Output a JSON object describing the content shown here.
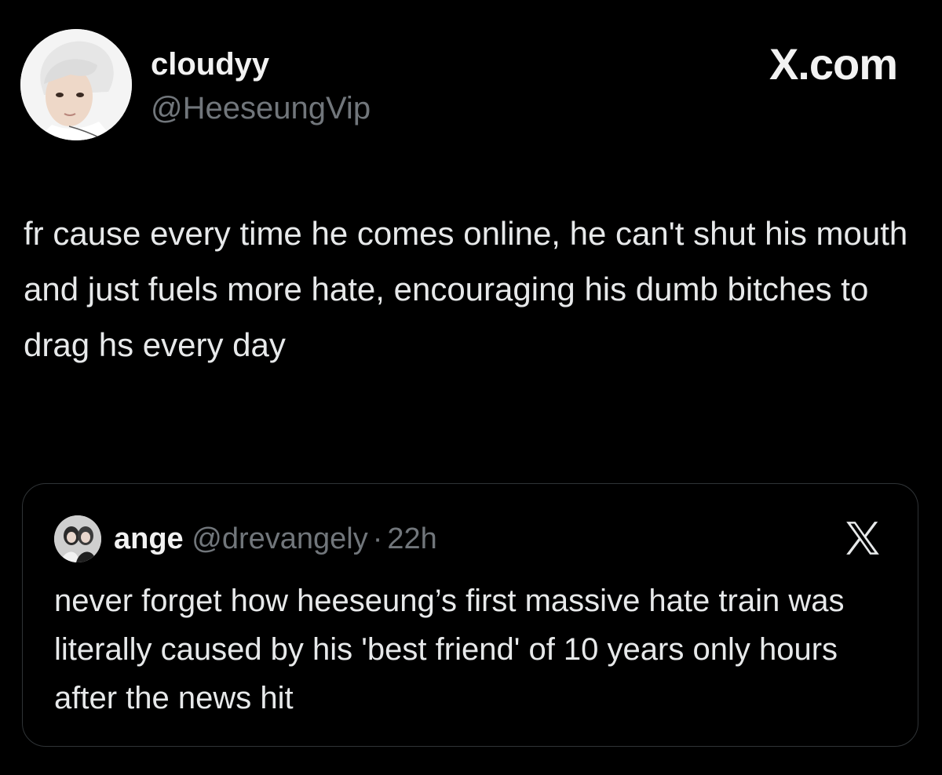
{
  "author": {
    "name": "cloudyy",
    "handle": "@HeeseungVip"
  },
  "brand": {
    "label": "X.com"
  },
  "post": {
    "text": "fr cause every time he comes online, he can't shut his mouth and just fuels more hate, encouraging his dumb bitches to drag hs every day"
  },
  "quote": {
    "name": "ange",
    "handle": "@drevangely",
    "separator": "·",
    "time": "22h",
    "text": "never forget how heeseung’s first massive hate train was literally caused by his 'best friend' of 10 years only hours after the news hit"
  },
  "icons": {
    "avatar": "profile-photo",
    "quote_avatar": "profile-photo",
    "quote_logo": "x-logo-icon"
  },
  "colors": {
    "background": "#000000",
    "text": "#e7e9ea",
    "muted": "#71767b",
    "border": "#2f3336"
  }
}
